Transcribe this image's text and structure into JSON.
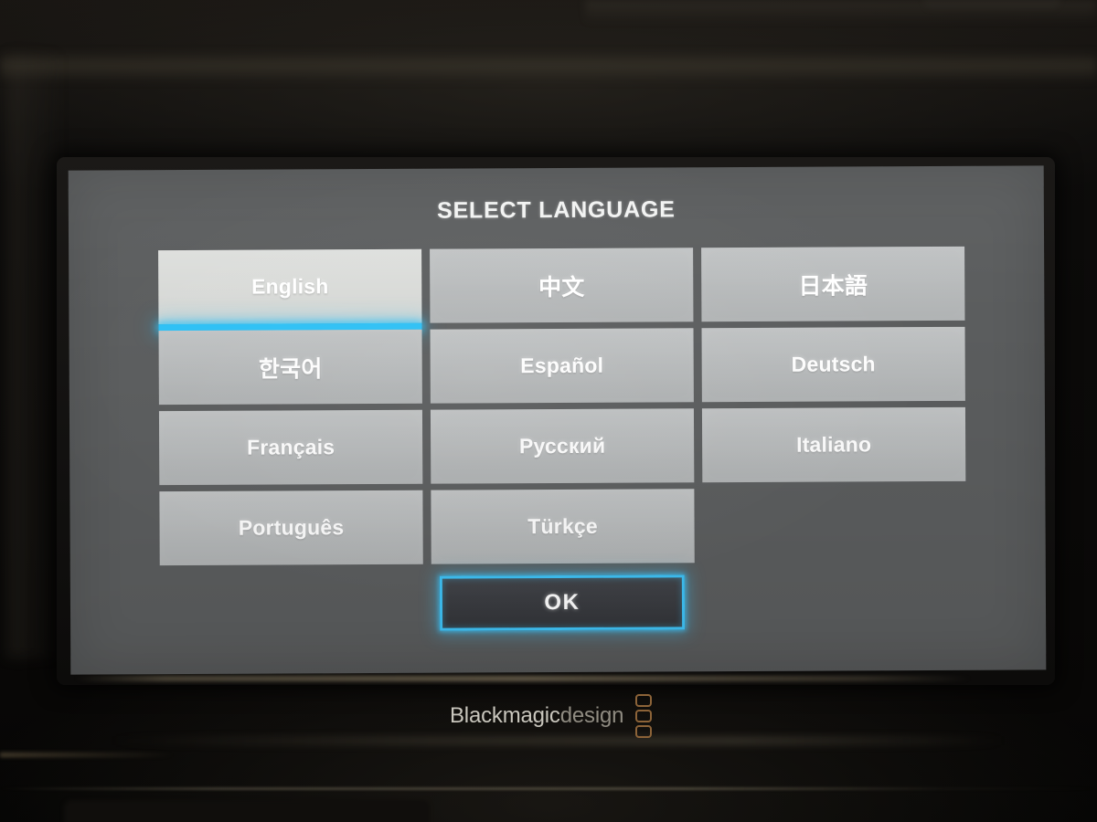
{
  "device": {
    "brand_primary": "Blackmagic",
    "brand_secondary": "design",
    "brand_logo_name": "blackmagic-logo-icon"
  },
  "dialog": {
    "title": "SELECT LANGUAGE",
    "confirm_label": "OK"
  },
  "languages": [
    {
      "label": "English",
      "selected": true,
      "script": "latin"
    },
    {
      "label": "中文",
      "selected": false,
      "script": "cjk"
    },
    {
      "label": "日本語",
      "selected": false,
      "script": "cjk"
    },
    {
      "label": "한국어",
      "selected": false,
      "script": "cjk"
    },
    {
      "label": "Español",
      "selected": false,
      "script": "latin"
    },
    {
      "label": "Deutsch",
      "selected": false,
      "script": "latin"
    },
    {
      "label": "Français",
      "selected": false,
      "script": "latin"
    },
    {
      "label": "Русский",
      "selected": false,
      "script": "cyrillic"
    },
    {
      "label": "Italiano",
      "selected": false,
      "script": "latin"
    },
    {
      "label": "Português",
      "selected": false,
      "script": "latin"
    },
    {
      "label": "Türkçe",
      "selected": false,
      "script": "latin"
    }
  ],
  "colors": {
    "accent_cyan": "#2cc0f5",
    "ok_border": "#3fc3f7",
    "panel_background": "#5b5d5e",
    "button_background": "#b9bcbd",
    "button_selected_background": "#d3d5d2",
    "ok_fill": "#3a3c41",
    "brand_copper": "#8c6338"
  }
}
